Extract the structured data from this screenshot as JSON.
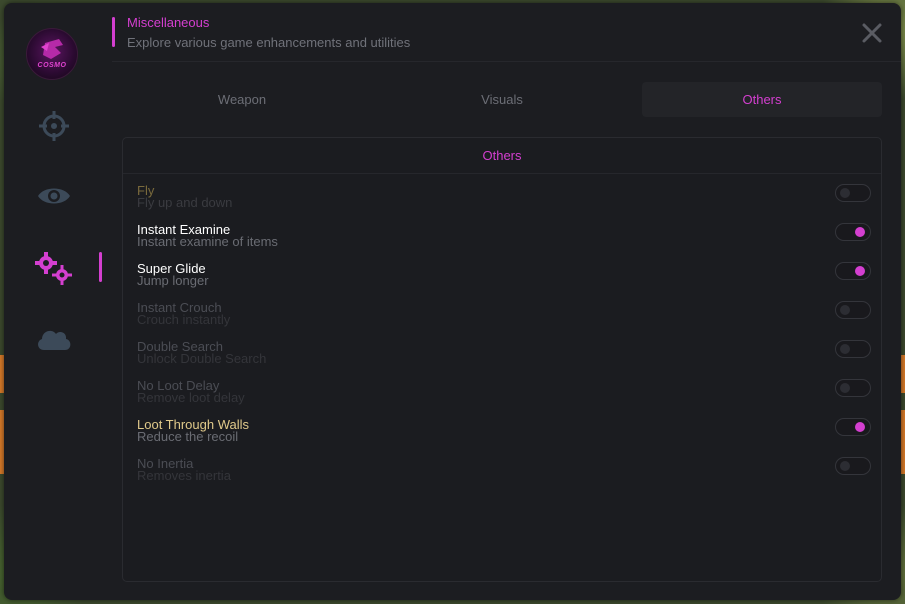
{
  "header": {
    "title": "Miscellaneous",
    "subtitle": "Explore various game enhancements and utilities"
  },
  "logo": {
    "text": "COSMO"
  },
  "sidebar": {
    "items": [
      {
        "icon": "crosshair-icon",
        "active": false
      },
      {
        "icon": "eye-icon",
        "active": false
      },
      {
        "icon": "gears-icon",
        "active": true
      },
      {
        "icon": "cloud-icon",
        "active": false
      }
    ]
  },
  "tabs": [
    {
      "label": "Weapon",
      "active": false
    },
    {
      "label": "Visuals",
      "active": false
    },
    {
      "label": "Others",
      "active": true
    }
  ],
  "panel": {
    "title": "Others",
    "options": [
      {
        "label": "Fly",
        "desc": "Fly up and down",
        "enabled": false,
        "label_color": "#7a6a3c",
        "desc_color": "#3a3b40"
      },
      {
        "label": "Instant Examine",
        "desc": "Instant examine of items",
        "enabled": true,
        "label_color": "#ffffff",
        "desc_color": "#6a6c73"
      },
      {
        "label": "Super Glide",
        "desc": "Jump longer",
        "enabled": true,
        "label_color": "#ffffff",
        "desc_color": "#6a6c73"
      },
      {
        "label": "Instant Crouch",
        "desc": "Crouch instantly",
        "enabled": false,
        "label_color": "#4b4d54",
        "desc_color": "#34353a"
      },
      {
        "label": "Double Search",
        "desc": "Unlock Double Search",
        "enabled": false,
        "label_color": "#4b4d54",
        "desc_color": "#34353a"
      },
      {
        "label": "No Loot Delay",
        "desc": "Remove loot delay",
        "enabled": false,
        "label_color": "#4b4d54",
        "desc_color": "#34353a"
      },
      {
        "label": "Loot Through Walls",
        "desc": "Reduce the recoil",
        "enabled": true,
        "label_color": "#e0c98a",
        "desc_color": "#6a6c73"
      },
      {
        "label": "No Inertia",
        "desc": "Removes inertia",
        "enabled": false,
        "label_color": "#4b4d54",
        "desc_color": "#34353a"
      }
    ]
  },
  "colors": {
    "accent": "#d43fd0",
    "background": "#1c1d21",
    "icon": "#3c4a59"
  }
}
